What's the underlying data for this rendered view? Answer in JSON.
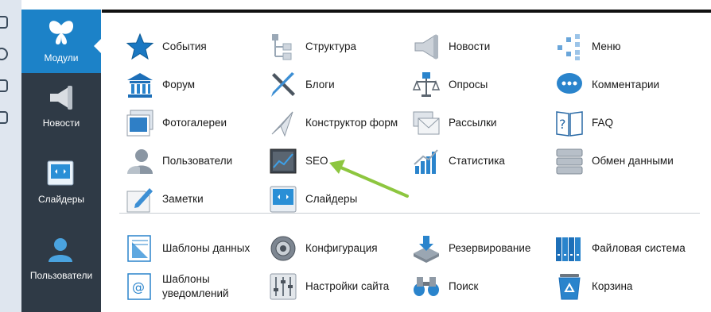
{
  "sidebar": {
    "items": [
      {
        "label": "Модули",
        "icon": "butterfly-icon",
        "active": true
      },
      {
        "label": "Новости",
        "icon": "megaphone-icon",
        "active": false
      },
      {
        "label": "Слайдеры",
        "icon": "slider-icon",
        "active": false
      },
      {
        "label": "Пользователи",
        "icon": "user-icon",
        "active": false
      }
    ]
  },
  "modules": {
    "items": [
      {
        "label": "События",
        "icon": "star-icon"
      },
      {
        "label": "Структура",
        "icon": "structure-icon"
      },
      {
        "label": "Новости",
        "icon": "megaphone-icon"
      },
      {
        "label": "Меню",
        "icon": "menu-tree-icon"
      },
      {
        "label": "Форум",
        "icon": "building-icon"
      },
      {
        "label": "Блоги",
        "icon": "pencil-cross-icon"
      },
      {
        "label": "Опросы",
        "icon": "scales-icon"
      },
      {
        "label": "Комментарии",
        "icon": "speech-bubble-icon"
      },
      {
        "label": "Фотогалереи",
        "icon": "photo-icon"
      },
      {
        "label": "Конструктор форм",
        "icon": "paper-plane-icon"
      },
      {
        "label": "Рассылки",
        "icon": "envelope-icon"
      },
      {
        "label": "FAQ",
        "icon": "question-book-icon"
      },
      {
        "label": "Пользователи",
        "icon": "user-icon"
      },
      {
        "label": "SEO",
        "icon": "chart-monitor-icon"
      },
      {
        "label": "Статистика",
        "icon": "bar-chart-icon"
      },
      {
        "label": "Обмен данными",
        "icon": "server-icon"
      },
      {
        "label": "Заметки",
        "icon": "note-icon"
      },
      {
        "label": "Слайдеры",
        "icon": "slider-icon"
      }
    ]
  },
  "system": {
    "items": [
      {
        "label": "Шаблоны данных",
        "icon": "template-icon"
      },
      {
        "label": "Конфигурация",
        "icon": "gear-icon"
      },
      {
        "label": "Резервирование",
        "icon": "backup-icon"
      },
      {
        "label": "Файловая система",
        "icon": "binders-icon"
      },
      {
        "label1": "Шаблоны",
        "label2": "уведомлений",
        "icon": "email-template-icon"
      },
      {
        "label": "Настройки сайта",
        "icon": "sliders-icon"
      },
      {
        "label": "Поиск",
        "icon": "binoculars-icon"
      },
      {
        "label": "Корзина",
        "icon": "recycle-bin-icon"
      }
    ]
  },
  "colors": {
    "sidebar_bg": "#2f3a46",
    "sidebar_active": "#1c82c8",
    "annotation_arrow": "#8dc63f"
  }
}
